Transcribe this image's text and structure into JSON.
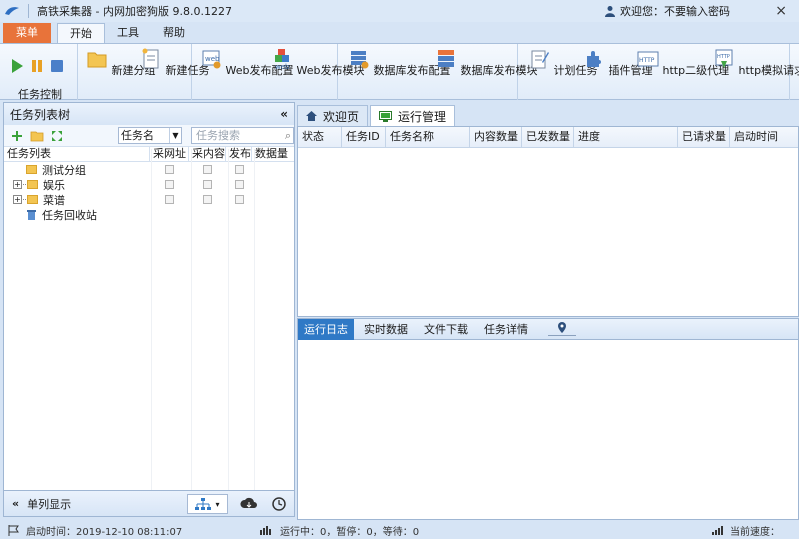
{
  "window": {
    "title": "高铁采集器 - 内网加密狗版 9.8.0.1227",
    "welcome": "欢迎您：不要输入密码",
    "close": "×"
  },
  "ribbon_tabs": {
    "menu": "菜单",
    "tabs": [
      "开始",
      "工具",
      "帮助"
    ]
  },
  "ribbon": {
    "task_control_label": "任务控制",
    "buttons": [
      {
        "label": "新建分组",
        "icon": "folder-new-icon"
      },
      {
        "label": "新建任务",
        "icon": "new-task-icon"
      },
      {
        "label": "Web发布配置",
        "icon": "web-config-icon"
      },
      {
        "label": "Web发布模块",
        "icon": "web-module-icon"
      },
      {
        "label": "数据库发布配置",
        "icon": "db-config-icon"
      },
      {
        "label": "数据库发布模块",
        "icon": "db-module-icon"
      },
      {
        "label": "计划任务",
        "icon": "schedule-icon"
      },
      {
        "label": "插件管理",
        "icon": "plugin-icon"
      },
      {
        "label": "http二级代理",
        "icon": "http-proxy-icon"
      },
      {
        "label": "http模拟请求",
        "icon": "http-request-icon"
      }
    ]
  },
  "left_panel": {
    "title": "任务列表树",
    "collapse": "«",
    "filter_select": "任务名",
    "search_placeholder": "任务搜索",
    "columns": [
      "任务列表",
      "采网址",
      "采内容",
      "发布",
      "数据量"
    ],
    "tree": [
      {
        "label": "测试分组",
        "expandable": false,
        "checks": true
      },
      {
        "label": "娱乐",
        "expandable": true,
        "checks": true
      },
      {
        "label": "菜谱",
        "expandable": true,
        "checks": true
      },
      {
        "label": "任务回收站",
        "expandable": false,
        "checks": false
      }
    ],
    "bottom_label": "单列显示"
  },
  "doc_tabs": [
    "欢迎页",
    "运行管理"
  ],
  "run_table": {
    "columns": [
      "状态",
      "任务ID",
      "任务名称",
      "内容数量",
      "已发数量",
      "进度",
      "已请求量",
      "启动时间"
    ]
  },
  "bottom_tabs": [
    "运行日志",
    "实时数据",
    "文件下载",
    "任务详情"
  ],
  "status": {
    "start_time": "启动时间：2019-12-10 08:11:07",
    "running": "运行中：0，暂停：0，等待：0",
    "speed": "当前速度："
  }
}
